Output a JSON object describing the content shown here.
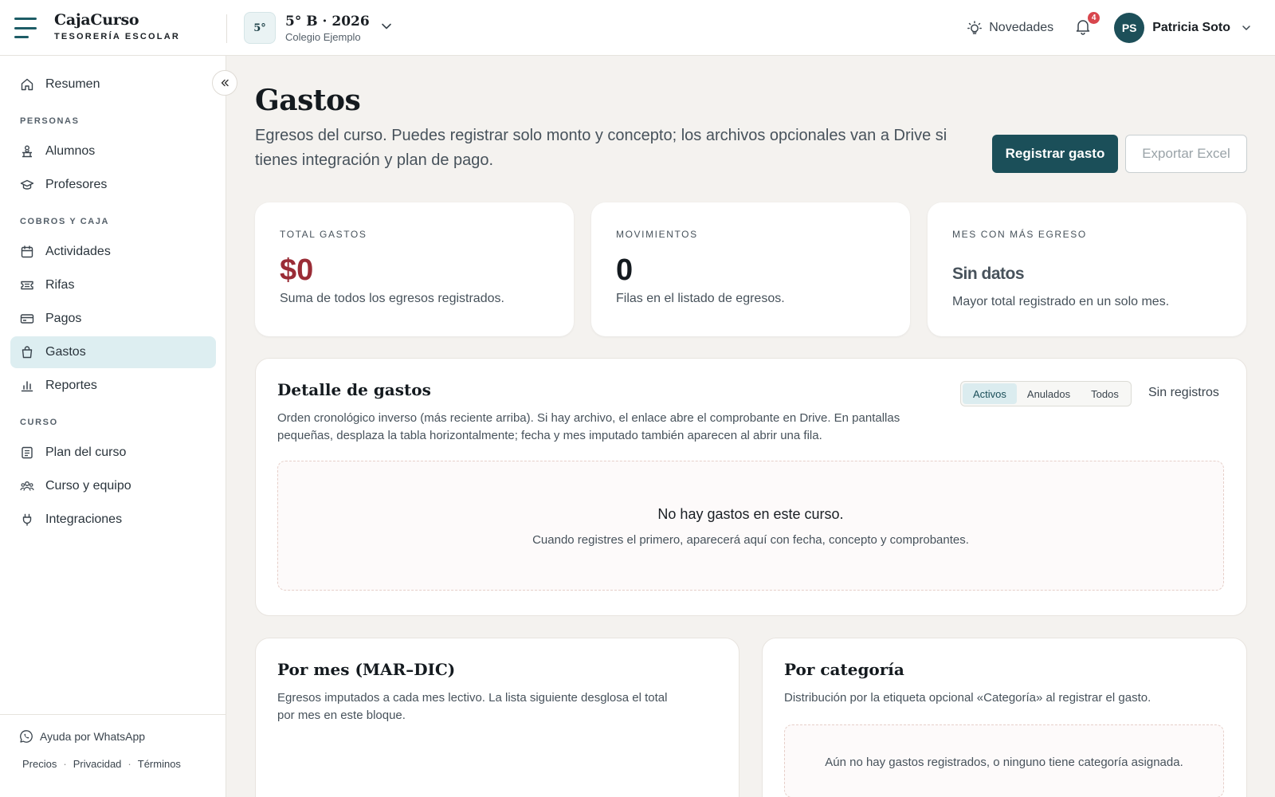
{
  "app": {
    "brand_name": "CajaCurso",
    "brand_sub": "TESORERÍA ESCOLAR"
  },
  "course": {
    "badge": "5°",
    "name": "5° B · 2026",
    "school": "Colegio Ejemplo"
  },
  "header": {
    "news_label": "Novedades",
    "notifications_count": "4",
    "user_initials": "PS",
    "user_name": "Patricia Soto"
  },
  "sidebar": {
    "home": "Resumen",
    "sections": [
      {
        "title": "PERSONAS",
        "items": [
          "Alumnos",
          "Profesores"
        ]
      },
      {
        "title": "COBROS Y CAJA",
        "items": [
          "Actividades",
          "Rifas",
          "Pagos",
          "Gastos",
          "Reportes"
        ]
      },
      {
        "title": "CURSO",
        "items": [
          "Plan del curso",
          "Curso y equipo",
          "Integraciones"
        ]
      }
    ],
    "active_item": "Gastos",
    "help": "Ayuda por WhatsApp",
    "footer_links": [
      "Precios",
      "Privacidad",
      "Términos"
    ],
    "footer_separator": "·"
  },
  "page": {
    "title": "Gastos",
    "description": "Egresos del curso. Puedes registrar solo monto y concepto; los archivos opcionales van a Drive si tienes integración y plan de pago.",
    "primary_button": "Registrar gasto",
    "secondary_button": "Exportar Excel"
  },
  "stats": [
    {
      "label": "TOTAL GASTOS",
      "value": "$0",
      "note": "Suma de todos los egresos registrados."
    },
    {
      "label": "MOVIMIENTOS",
      "value": "0",
      "note": "Filas en el listado de egresos."
    },
    {
      "label": "MES CON MÁS EGRESO",
      "value": "Sin datos",
      "note": "Mayor total registrado en un solo mes."
    }
  ],
  "detail": {
    "title": "Detalle de gastos",
    "description_line1": "Orden cronológico inverso (más reciente arriba). Si hay archivo, el enlace abre el comprobante en Drive. En pantallas",
    "description_line2": "pequeñas, desplaza la tabla horizontalmente; fecha y mes imputado también aparecen al abrir una fila.",
    "filters": [
      "Activos",
      "Anulados",
      "Todos"
    ],
    "active_filter": "Activos",
    "records_label": "Sin registros",
    "empty_title": "No hay gastos en este curso.",
    "empty_subtitle": "Cuando registres el primero, aparecerá aquí con fecha, concepto y comprobantes."
  },
  "by_month": {
    "title": "Por mes (MAR–DIC)",
    "description_line1": "Egresos imputados a cada mes lectivo. La lista siguiente desglosa el total",
    "description_line2": "por mes en este bloque."
  },
  "by_category": {
    "title": "Por categoría",
    "description": "Distribución por la etiqueta opcional «Categoría» al registrar el gasto.",
    "empty": "Aún no hay gastos registrados, o ninguno tiene categoría asignada."
  },
  "colors": {
    "accent": "#1b4f59",
    "active_nav": "#ddeef1",
    "negative": "#9a2c36",
    "badge": "#d8464d"
  }
}
